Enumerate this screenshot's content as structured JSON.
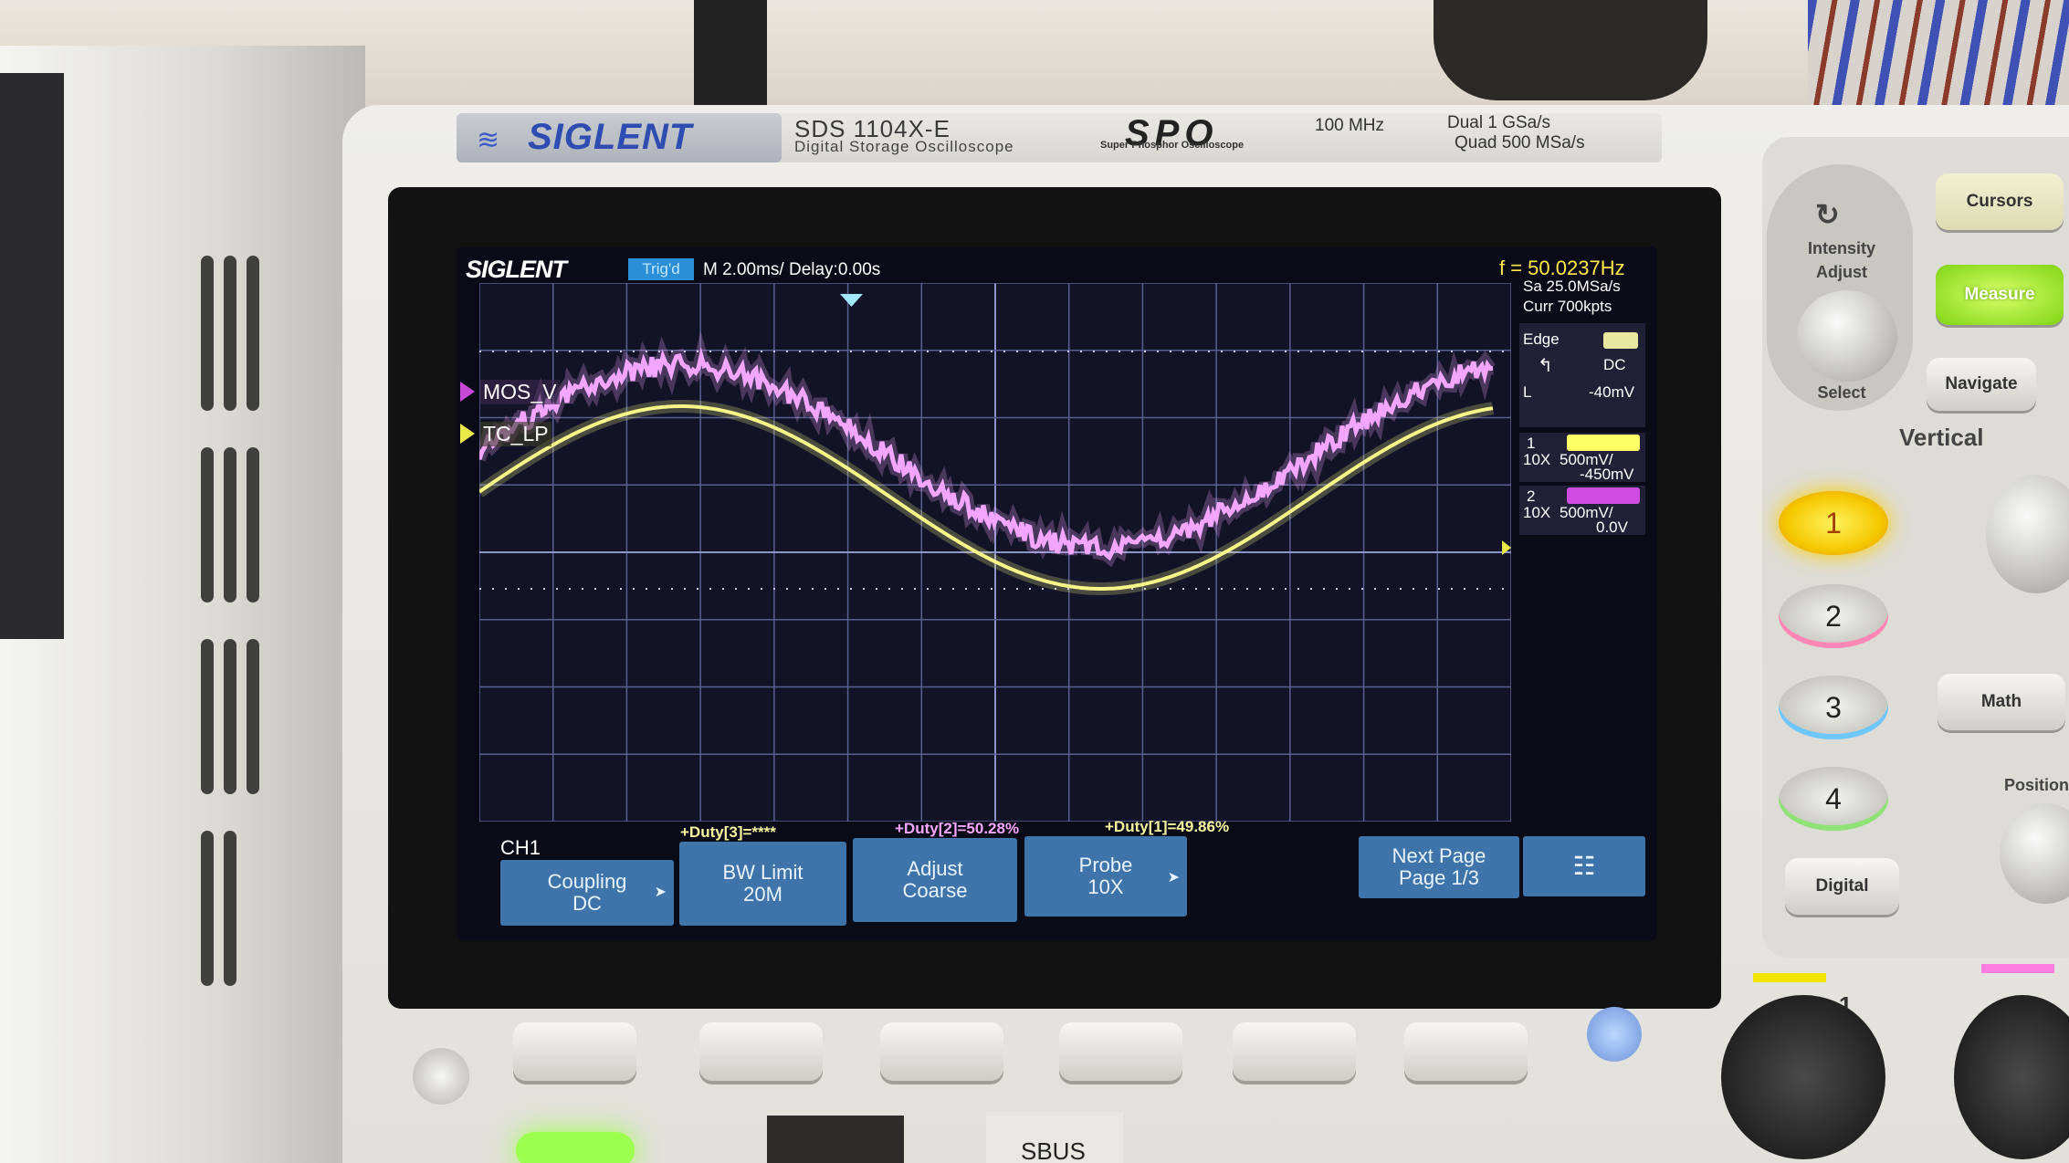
{
  "scope": {
    "brand": "SIGLENT",
    "model": "SDS 1104X-E",
    "model_subtitle": "Digital Storage Oscilloscope",
    "series_logo": "SPO",
    "series_subtitle": "Super Phosphor Oscilloscope",
    "bandwidth": "100 MHz",
    "spec_line1": "Dual  1 GSa/s",
    "spec_line2": "Quad  500 MSa/s"
  },
  "screen": {
    "logo": "SIGLENT",
    "status": "Trig'd",
    "timebase": "M 2.00ms/ Delay:0.00s",
    "frequency": "f = 50.0237Hz"
  },
  "side_panel": {
    "sample_rate": "Sa 25.0MSa/s",
    "memory_depth": "Curr 700kpts",
    "trigger_type": "Edge",
    "trigger_coupling": "DC",
    "trigger_level_label": "L",
    "trigger_level": "-40mV",
    "ch1": {
      "number": "1",
      "probe": "10X",
      "scale": "500mV/",
      "offset": "-450mV",
      "color": "#ffff55"
    },
    "ch2": {
      "number": "2",
      "probe": "10X",
      "scale": "500mV/",
      "offset": "0.0V",
      "color": "#d04ce0"
    }
  },
  "channel_markers": {
    "mos": {
      "label": "MOS_V",
      "color": "#c74ad6"
    },
    "tc": {
      "label": "TC_LP",
      "color": "#e9e94a"
    }
  },
  "measurements": {
    "duty3": "+Duty[3]=****",
    "duty2": "+Duty[2]=50.28%",
    "duty1": "+Duty[1]=49.86%"
  },
  "menu": {
    "channel": "CH1",
    "coupling": {
      "title": "Coupling",
      "value": "DC"
    },
    "bw_limit": {
      "title": "BW Limit",
      "value": "20M"
    },
    "adjust": {
      "title": "Adjust",
      "value": "Coarse"
    },
    "probe": {
      "title": "Probe",
      "value": "10X"
    },
    "next_page": {
      "title": "Next Page",
      "value": "Page 1/3"
    }
  },
  "panel": {
    "intensity": "Intensity",
    "adjust": "Adjust",
    "select": "Select",
    "cursors": "Cursors",
    "measure": "Measure",
    "navigate": "Navigate",
    "vertical": "Vertical",
    "ch_buttons": [
      "1",
      "2",
      "3",
      "4"
    ],
    "math": "Math",
    "digital": "Digital",
    "position": "Position",
    "ch1_input": "1"
  },
  "ports": {
    "sbus": "SBUS"
  },
  "waveforms": {
    "frequency_hz": 50.0237,
    "ch2_color": "#f2a6ff",
    "ch1_color": "#f5f58a"
  }
}
